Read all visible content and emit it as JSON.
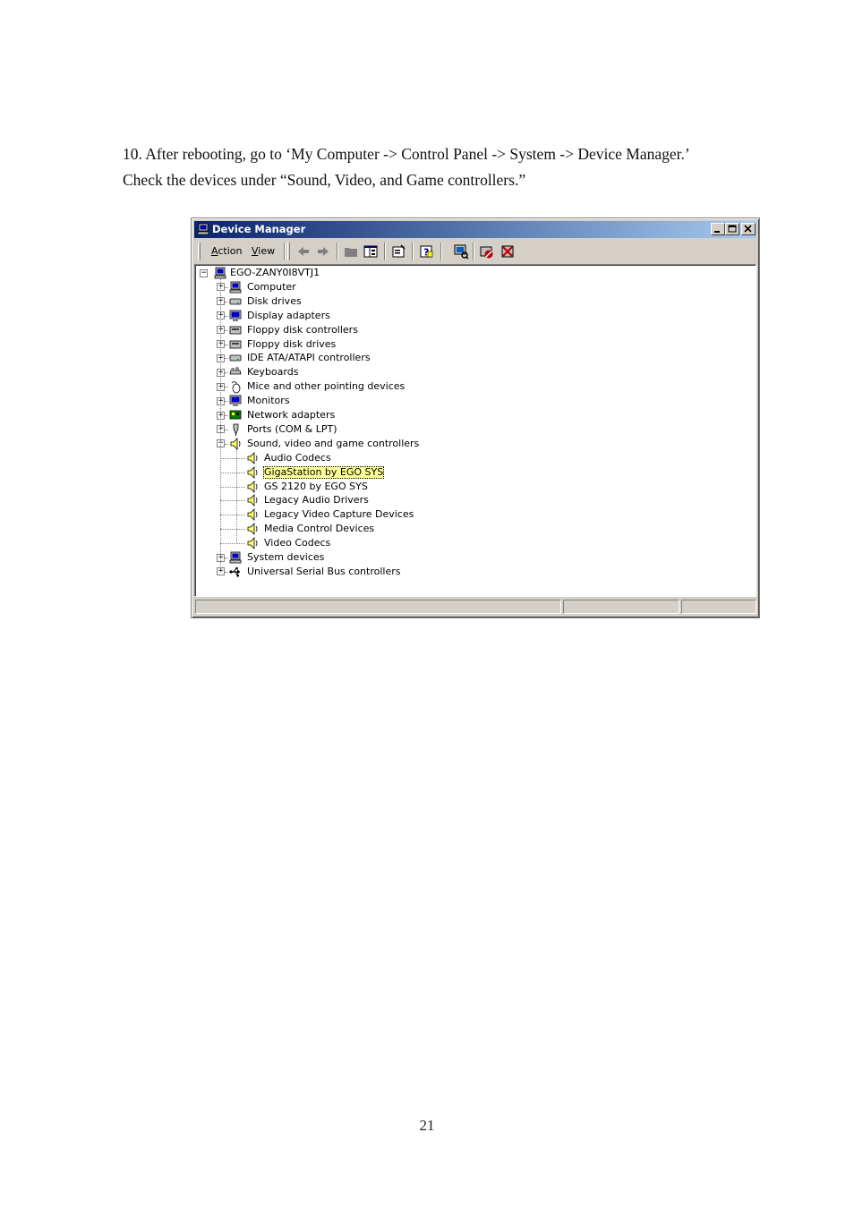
{
  "instructions": {
    "line1": "10. After rebooting, go to ‘My Computer -> Control Panel -> System -> Device Manager.’",
    "line2": "Check the devices under “Sound, Video, and Game controllers.”"
  },
  "window": {
    "title": "Device Manager",
    "menu": {
      "action_label": "Action",
      "action_key": "A",
      "action_rest": "ction",
      "view_label": "View",
      "view_key": "V",
      "view_rest": "iew"
    },
    "toolbar_icons": [
      "back-arrow-icon",
      "forward-arrow-icon",
      "folder-icon",
      "show-hide-tree-icon",
      "properties-icon",
      "help-icon",
      "scan-hardware-icon",
      "disable-device-icon",
      "uninstall-device-icon"
    ]
  },
  "tree": {
    "root": "EGO-ZANY0I8VTJ1",
    "categories": [
      "Computer",
      "Disk drives",
      "Display adapters",
      "Floppy disk controllers",
      "Floppy disk drives",
      "IDE ATA/ATAPI controllers",
      "Keyboards",
      "Mice and other pointing devices",
      "Monitors",
      "Network adapters",
      "Ports (COM & LPT)",
      "Sound, video and game controllers"
    ],
    "sound_children": [
      "Audio Codecs",
      "GigaStation by EGO SYS",
      "GS 2120 by EGO SYS",
      "Legacy Audio Drivers",
      "Legacy Video Capture Devices",
      "Media Control Devices",
      "Video Codecs"
    ],
    "tail_categories": [
      "System devices",
      "Universal Serial Bus controllers"
    ],
    "selected": "GigaStation by EGO SYS",
    "expand_plus": "+",
    "expand_minus": "−"
  },
  "page_number": "21",
  "colors": {
    "title_start": "#0a246a",
    "title_end": "#a6caf0",
    "selection": "#ffff99",
    "chrome": "#d4d0c8"
  }
}
